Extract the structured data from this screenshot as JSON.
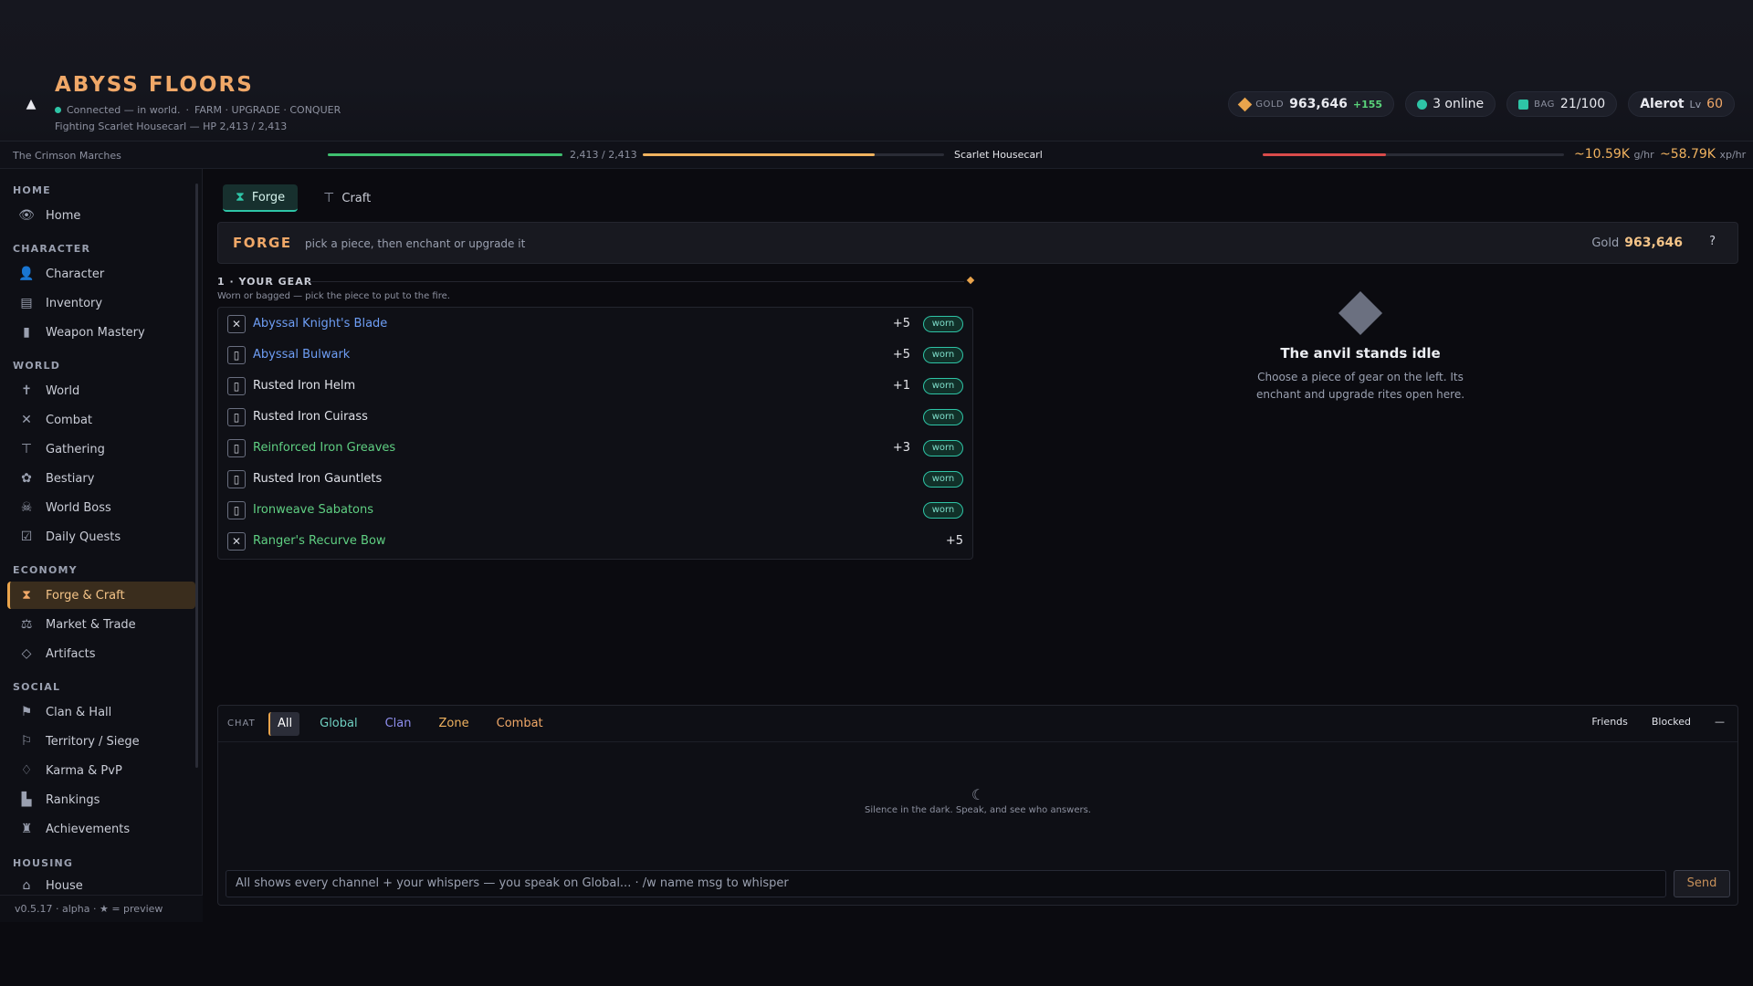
{
  "header": {
    "collapse_glyph": "▲",
    "title": "ABYSS FLOORS",
    "connection": "Connected — in world.",
    "motto": "FARM · UPGRADE · CONQUER",
    "fighting": "Fighting Scarlet Housecarl — HP 2,413 / 2,413",
    "gold_label": "GOLD",
    "gold_value": "963,646",
    "gold_gain": "+155",
    "online": "3 online",
    "bag_label": "BAG",
    "bag_value": "21/100",
    "player_name": "Alerot",
    "level_label": "Lv",
    "level_value": "60",
    "colors": {
      "accent": "#f0a868",
      "teal": "#2ec4a6",
      "gold": "#e9a44c"
    }
  },
  "status": {
    "zone": "The Crimson Marches",
    "player_hp_text": "2,413 / 2,413",
    "player_hp_fraction": 1.0,
    "xp_fraction": 0.77,
    "enemy_name": "Scarlet Housecarl",
    "enemy_hp_fraction": 0.41,
    "gold_rate": "~10.59K",
    "gold_rate_unit": "g/hr",
    "xp_rate": "~58.79K",
    "xp_rate_unit": "xp/hr"
  },
  "sidebar": {
    "sections": {
      "home": "HOME",
      "character": "CHARACTER",
      "world": "WORLD",
      "economy": "ECONOMY",
      "social": "SOCIAL",
      "housing": "HOUSING"
    },
    "items": {
      "home": "Home",
      "character": "Character",
      "inventory": "Inventory",
      "weapon_mastery": "Weapon Mastery",
      "world": "World",
      "combat": "Combat",
      "gathering": "Gathering",
      "bestiary": "Bestiary",
      "world_boss": "World Boss",
      "daily_quests": "Daily Quests",
      "forge_craft": "Forge & Craft",
      "market_trade": "Market & Trade",
      "artifacts": "Artifacts",
      "clan_hall": "Clan & Hall",
      "territory_siege": "Territory / Siege",
      "karma_pvp": "Karma & PvP",
      "rankings": "Rankings",
      "achievements": "Achievements",
      "house": "House"
    },
    "active": "forge_craft",
    "footer": "v0.5.17 · alpha · ★ = preview"
  },
  "main": {
    "tabs": {
      "forge": "Forge",
      "craft": "Craft"
    },
    "banner": {
      "title": "FORGE",
      "subtitle": "pick a piece, then enchant or upgrade it",
      "gold_label": "Gold",
      "gold_value": "963,646",
      "help": "?"
    },
    "gear_heading": "1 · YOUR GEAR",
    "gear_subheading": "Worn or bagged — pick the piece to put to the fire.",
    "worn_label": "worn",
    "gear": [
      {
        "name": "Abyssal Knight's Blade",
        "level": "+5",
        "worn": true,
        "icon": "crossed-swords-icon",
        "rarity_color": "#6e9ef5"
      },
      {
        "name": "Abyssal Bulwark",
        "level": "+5",
        "worn": true,
        "icon": "armor-icon",
        "rarity_color": "#6e9ef5"
      },
      {
        "name": "Rusted Iron Helm",
        "level": "+1",
        "worn": true,
        "icon": "armor-icon",
        "rarity_color": "#dfe1e8"
      },
      {
        "name": "Rusted Iron Cuirass",
        "level": "",
        "worn": true,
        "icon": "armor-icon",
        "rarity_color": "#dfe1e8"
      },
      {
        "name": "Reinforced Iron Greaves",
        "level": "+3",
        "worn": true,
        "icon": "armor-icon",
        "rarity_color": "#5fcf82"
      },
      {
        "name": "Rusted Iron Gauntlets",
        "level": "",
        "worn": true,
        "icon": "armor-icon",
        "rarity_color": "#dfe1e8"
      },
      {
        "name": "Ironweave Sabatons",
        "level": "",
        "worn": true,
        "icon": "armor-icon",
        "rarity_color": "#5fcf82"
      },
      {
        "name": "Ranger's Recurve Bow",
        "level": "+5",
        "worn": false,
        "icon": "crossed-swords-icon",
        "rarity_color": "#5fcf82"
      }
    ],
    "idle": {
      "title": "The anvil stands idle",
      "line1": "Choose a piece of gear on the left. Its",
      "line2": "enchant and upgrade rites open here."
    }
  },
  "chat": {
    "label": "CHAT",
    "tabs": {
      "all": "All",
      "global": "Global",
      "clan": "Clan",
      "zone": "Zone",
      "combat": "Combat"
    },
    "friends": "Friends",
    "blocked": "Blocked",
    "minimize": "—",
    "empty_message": "Silence in the dark. Speak, and see who answers.",
    "input_placeholder": "All shows every channel + your whispers — you speak on Global...   ·   /w name msg to whisper",
    "send": "Send"
  }
}
